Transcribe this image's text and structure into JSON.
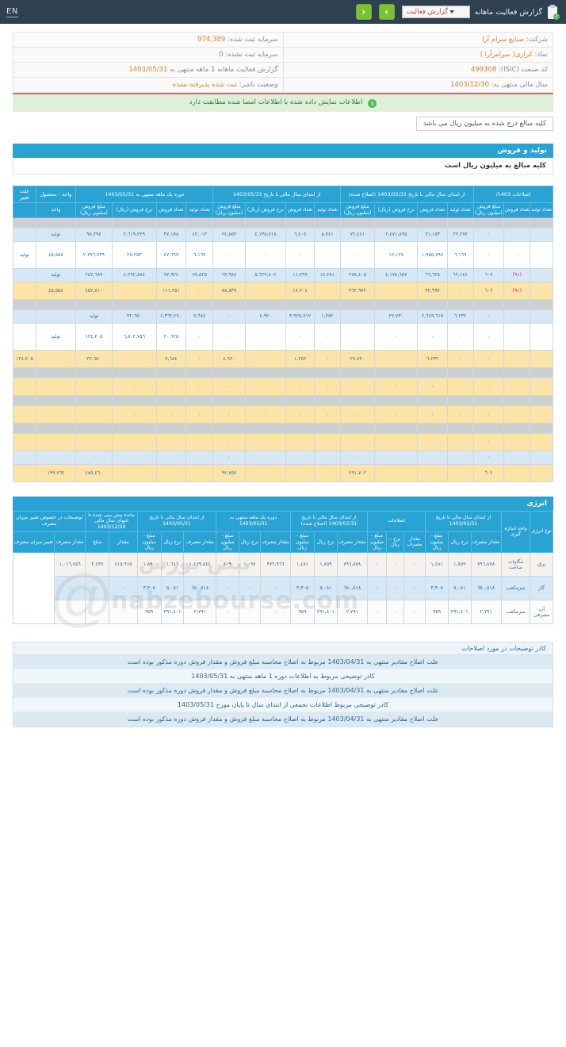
{
  "topbar": {
    "clip_icon": "clipboard-check-icon",
    "title": "گزارش فعالیت ماهانه",
    "selected_report": "گزارش فعالیت",
    "prev_label": "‹",
    "next_label": "›",
    "lang_toggle": "EN"
  },
  "company": {
    "name_label": "شرکت:",
    "name_value": "صنایع سرام آرا",
    "symbol_label": "نماد:",
    "symbol_value": "کرازی( سرامرآرا )",
    "isic_label": "کد صنعت (ISIC):",
    "isic_value": "499308",
    "fiscal_label": "سال مالی منتهی به:",
    "fiscal_value": "1403/12/30",
    "registered_capital_label": "سرمایه ثبت شده:",
    "registered_capital_value": "974,389",
    "unregistered_capital_label": "سرمایه ثبت نشده:",
    "unregistered_capital_value": "0",
    "report_period_label": "گزارش فعالیت ماهانه  1 ماهه منتهی به",
    "report_period_value": "1403/05/31",
    "publisher_status_label": "وضعیت ناشر:",
    "publisher_status_value": "ثبت شده پذیرفته نشده"
  },
  "notice": {
    "icon": "info-icon",
    "text": "اطلاعات نمایش داده شده با اطلاعات امضا شده مطابقت دارد"
  },
  "unit_note": "کلیه مبالغ درج شده به میلیون ریال می باشد",
  "sections": {
    "production_sales_title": "تولید و فروش",
    "production_sales_subtitle": "کلیه مبالغ به میلیون ریال است",
    "energy_title": "انرژی"
  },
  "main_table": {
    "group_headers": [
      "اصلاحات 1403/",
      "از ابتدای سال مالی تا تاریخ 1403/02/31 (اصلاح شده)",
      "از ابتدای سال مالی تا تاریخ 1403/05/31",
      "دوره یک ماهه منتهی به 1403/05/31",
      "از ابتدای سال مالی تا تاریخ 1403/05/31",
      "واحد - محصول",
      "علت تغییر"
    ],
    "col_headers": [
      "تعداد تولید",
      "تعداد فروش",
      "مبلغ فروش (میلیون ریال)",
      "تعداد تولید",
      "تعداد فروش",
      "نرخ فروش (ریال)",
      "مبلغ فروش (میلیون ریال)",
      "تعداد تولید",
      "تعداد فروش",
      "نرخ فروش (ریال)",
      "مبلغ فروش (میلیون ریال)",
      "تعداد تولید",
      "تعداد فروش",
      "نرخ فروش (ریال)",
      "مبلغ فروش (میلیون ریال)",
      "واحد"
    ],
    "rows": [
      {
        "style": "r-gray",
        "cells": [
          "",
          "",
          "",
          "",
          "",
          "",
          "",
          "",
          "",
          "",
          "",
          "",
          "",
          "",
          "",
          ""
        ]
      },
      {
        "style": "r-blue",
        "cells": [
          "",
          "",
          "٠",
          "٢٢,٢٧٢",
          "٢١,١٥٣",
          "٢,٤٧١,٨٩٥",
          "٧٢,٤٤١",
          "٨,٧٤١",
          "٦,٤٠٥",
          "٤,١٣٨,٧١٨",
          "٢٤,٨٥٢",
          "٤٢,٠١٢",
          "٢٧,١٥٨",
          "٢,٦١٩,٢٢٩",
          "٩٨,٢٩٤",
          "تولید"
        ]
      },
      {
        "style": "r-blank",
        "cells": [
          "",
          "٠",
          "٠",
          "٦,١٦٩",
          "١,٩٥٥,٧٩٧",
          "١٢,١٢٧",
          "٠",
          "",
          "٠",
          "٠",
          "٠",
          "٦,١٦٩",
          "٤٧,٦٩٧",
          "٢٧,٢٥٣",
          "٢,٢٩٦,٧٣٩",
          "٤٥,٥٥٨",
          "تولید"
        ]
      },
      {
        "style": "r-blue",
        "cells": [
          "",
          "(٩١)",
          "٦٠٢",
          "٦٢,١٤٤",
          "٦٦,٦٢٥",
          "٤,١٧٨,٦٨٧",
          "٢٧٨,٤٠٥",
          "١٤,٢٨١",
          "١١,٢٩٩",
          "٥,٦٢٢,٨٠٢",
          "٦٢,٩٨٤",
          "٧٧,٥٢٥",
          "٧٧,٩٢٤",
          "٤,٢٩٢,٨٨٤",
          "٢٤٢,٦٨٩",
          "تولید"
        ]
      },
      {
        "style": "r-yellow",
        "cells": [
          "٠",
          "(٩١)",
          "٦٠٢",
          "٠",
          "٩٢,٩٩٧",
          "",
          "٣٦٢,٩٧٢",
          "٠",
          "١٧,٢٠٤",
          "",
          "٨٨,٨٣٧",
          "٠",
          "١١١,٢٥١",
          "",
          "٤٥٢,٨١٠",
          "٤٥,٥٥٨"
        ]
      },
      {
        "style": "r-gray",
        "cells": [
          "",
          "",
          "",
          "",
          "",
          "",
          "",
          "",
          "",
          "",
          "",
          "",
          "",
          "",
          "",
          ""
        ]
      },
      {
        "style": "r-blue",
        "cells": [
          "",
          "",
          "٠",
          "٦,٢٣٢",
          "٢,٦٤٩,٦١٥",
          "٢٧,٧٣٠",
          "",
          "١,٢٥٢",
          "٣,٩٢٥,٧١٢",
          "٤,٩٢٠",
          "٠",
          "٧,٦٨٤",
          "٤,٣٦٢,٢٤٠",
          "٣٢,٦٥٠",
          "تولید"
        ]
      },
      {
        "style": "r-blank",
        "cells": [
          "",
          "٠",
          "٠",
          "٠",
          "٠",
          "٠",
          "٠",
          "٠",
          "٠",
          "٠",
          "٠",
          "٠",
          "٢٠,٦٢٥",
          "٦,٥٠٢,٧٥٦",
          "١٢٤,٢٠٥",
          "تولید"
        ]
      },
      {
        "style": "r-yellow",
        "cells": [
          "٠",
          "٠",
          "٠",
          "٠",
          "٦,٢٣٢",
          "",
          "٢٧,٧٣٠",
          "٠",
          "١,٢٥٢",
          "",
          "٤,٩٢٠",
          "٠",
          "٧,٦٨٤",
          "",
          "٢٢,٦٥٠",
          "٠",
          "١٢٤,٢٠٥",
          "٢٠,٦٢٥"
        ]
      },
      {
        "style": "r-gray",
        "cells": [
          "",
          "",
          "",
          "",
          "",
          "",
          "",
          "",
          "",
          "",
          "",
          "",
          "",
          "",
          "",
          ""
        ]
      },
      {
        "style": "r-yellow",
        "cells": [
          "٠",
          "٠",
          "٠",
          "٠",
          "٠",
          "٠",
          "٠",
          "٠",
          "٠",
          "٠",
          "٠",
          "٠",
          "٠",
          "٠",
          "٠",
          "٠"
        ]
      },
      {
        "style": "r-gray",
        "cells": [
          "",
          "",
          "",
          "",
          "",
          "",
          "",
          "",
          "",
          "",
          "",
          "",
          "",
          "",
          "",
          ""
        ]
      },
      {
        "style": "r-yellow",
        "cells": [
          "٠",
          "٠",
          "٠",
          "٠",
          "٠",
          "٠",
          "٠",
          "٠",
          "٠",
          "٠",
          "٠",
          "٠",
          "٠",
          "٠",
          "٠",
          "٠"
        ]
      },
      {
        "style": "r-gray",
        "cells": [
          "",
          "",
          "",
          "",
          "",
          "",
          "",
          "",
          "",
          "",
          "",
          "",
          "",
          "",
          "",
          ""
        ]
      },
      {
        "style": "r-yellow",
        "cells": [
          "",
          "٠",
          "٠",
          "",
          "",
          "",
          "٠",
          "",
          "",
          "",
          "٠",
          "",
          "",
          "",
          "٠",
          ""
        ]
      },
      {
        "style": "r-blue",
        "cells": [
          "",
          "",
          "٠",
          "",
          "",
          "",
          "٠",
          "",
          "",
          "",
          "٠",
          "",
          "",
          "",
          "٠",
          ""
        ]
      },
      {
        "style": "r-yellow",
        "cells": [
          "",
          "",
          "٦٠٢",
          "",
          "",
          "",
          "٢٩١,٧٠٢",
          "",
          "",
          "",
          "٩٢,٧٥٧",
          "",
          "",
          "",
          "٤٨٥,٤٦٠",
          "١٩٩,٧٦٢"
        ]
      }
    ]
  },
  "energy_table": {
    "group_headers": [
      "نوع انرژی",
      "واحد اندازه گیری",
      "از ابتدای سال مالی تا تاریخ 1403/02/31",
      "اصلاحات",
      "از ابتدای سال مالی تا تاریخ 1403/02/31 (اصلاح شده)",
      "دوره یک ماهه منتهی به 1403/05/31",
      "از ابتدای سال مالی تا تاریخ 1403/05/31",
      "از ابتدای سال مالی تا تاریخ 1403/05/31",
      "مانده پیش بینی شده تا انتهای سال مالی 1403/12/20",
      "توضیحات در خصوص تغییر میزان مصرف"
    ],
    "col_headers": [
      "مقدار مصرف",
      "نرخ ریال",
      "مبلغ - میلیون ریال",
      "مقدار مصرف",
      "نرخ - ریال",
      "مبلغ - میلیون ریال",
      "مقدار مصرف",
      "نرخ ریال",
      "مبلغ - میلیون ریال",
      "مقدار مصرف",
      "نرخ ریال",
      "مبلغ - میلیون ریال",
      "مقدار مصرف",
      "نرخ ریال",
      "مبلغ - میلیون ریال",
      "مقدار",
      "مبلغ",
      "مقدار مصرف",
      "تغییر میزان مصرف"
    ],
    "rows": [
      {
        "style": "e-white",
        "type": "برق",
        "unit": "مگاوات ساعت",
        "cells": [
          "٧٩٦,٨٧٨",
          "١,٨٥٩",
          "١,٤٨١",
          "٠",
          "٠",
          "٠",
          "٧٩٦,٨٧٨",
          "١,٨٥٩",
          "١,٤٨١",
          "٣٧٢,٩٦٦",
          "١,٠٩٧",
          "٤٠٩",
          "١,١٦٩,٨٤٤",
          "١,٦١٦",
          "١,٨٩٠",
          "٤١٥,٩١٥",
          "٢,٤٣٧",
          "١,٠١٦,٧٥٦",
          ""
        ]
      },
      {
        "style": "e-blue",
        "type": "گاز",
        "unit": "مترمکعب",
        "cells": [
          "٦٥٠,٥١٨",
          "٥,٠٨١",
          "٣,٣٠٥",
          "٠",
          "٠",
          "٠",
          "٦٥٠,٥١٨",
          "٥,٠٨١",
          "٣,٣٠٥",
          "٠",
          "٠",
          "٠",
          "٦٥٠,٥١٨",
          "٥,٠٨١",
          "٣,٣٠٥",
          "٠",
          "٠",
          "٠",
          ""
        ]
      },
      {
        "style": "e-white2",
        "type": "آب مصرفی",
        "unit": "مترمکعب",
        "cells": [
          "٢,٧٩١",
          "٢٩١,٤٠١",
          "٩٥٩",
          "٠",
          "٠",
          "٠",
          "٢,٧٩١",
          "٢٩١,٤٠١",
          "٩٥٩",
          "٠",
          "٠",
          "٠",
          "٢,٧٩١",
          "٢٩١,٤٠١",
          "٩٥٩",
          "٠",
          "٠",
          "٠",
          ""
        ]
      }
    ]
  },
  "footnotes": {
    "header": "کادر توضیحات در مورد اصلاحات",
    "items": [
      "علت اصلاح مقادیر منتهی به 1403/04/31 مربوط به اصلاح محاسبه مبلغ فروش و مقدار فروش دوره مذکور بوده است",
      "کادر توضیحی مربوط به اطلاعات دوره 1 ماهه منتهی به 1403/05/31",
      "علت اصلاح مقادیر منتهی به 1403/04/31 مربوط به اصلاح محاسبه مبلغ فروش و مقدار فروش دوره مذکور بوده است",
      "کادر توضیحی مربوط اطلاعات تجمعی از ابتدای سال تا پایان مورخ 1403/05/31",
      "علت اصلاح مقادیر منتهی به 1403/04/31 مربوط به اصلاح محاسبه مبلغ فروش و مقدار فروش دوره مذکور بوده است"
    ]
  },
  "watermark": {
    "site": "nabzebourse.com",
    "brand": "نبض بورس",
    "handle": "@"
  },
  "colors": {
    "topbar": "#2f4050",
    "accent": "#29a3d4",
    "green": "#7cc132",
    "highlight_yellow": "#fce3a8",
    "row_blue": "#d6e7f5",
    "negative": "#e0245e"
  }
}
